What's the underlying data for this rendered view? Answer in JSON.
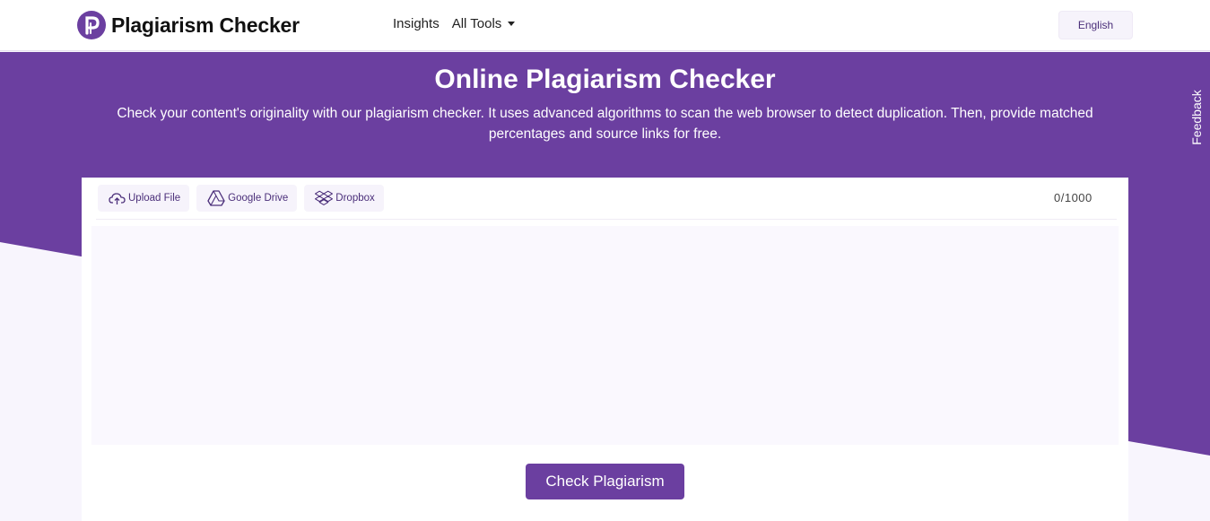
{
  "header": {
    "brand": "Plagiarism Checker",
    "nav": {
      "insights": "Insights",
      "all_tools": "All Tools"
    },
    "language": "English"
  },
  "hero": {
    "title": "Online Plagiarism Checker",
    "subtitle": "Check your content's originality with our plagiarism checker. It uses advanced algorithms to scan the web browser to detect duplication. Then, provide matched percentages and source links for free."
  },
  "feedback_label": "Feedback",
  "editor": {
    "tools": {
      "upload": "Upload File",
      "drive": "Google Drive",
      "dropbox": "Dropbox"
    },
    "counter": "0/1000",
    "placeholder": "",
    "submit_label": "Check Plagiarism"
  },
  "colors": {
    "brand": "#6b3fa0",
    "accent_light": "#f6f3fb"
  },
  "icons": [
    "logo-p-icon",
    "chevron-down-icon",
    "cloud-upload-icon",
    "google-drive-icon",
    "dropbox-icon"
  ]
}
